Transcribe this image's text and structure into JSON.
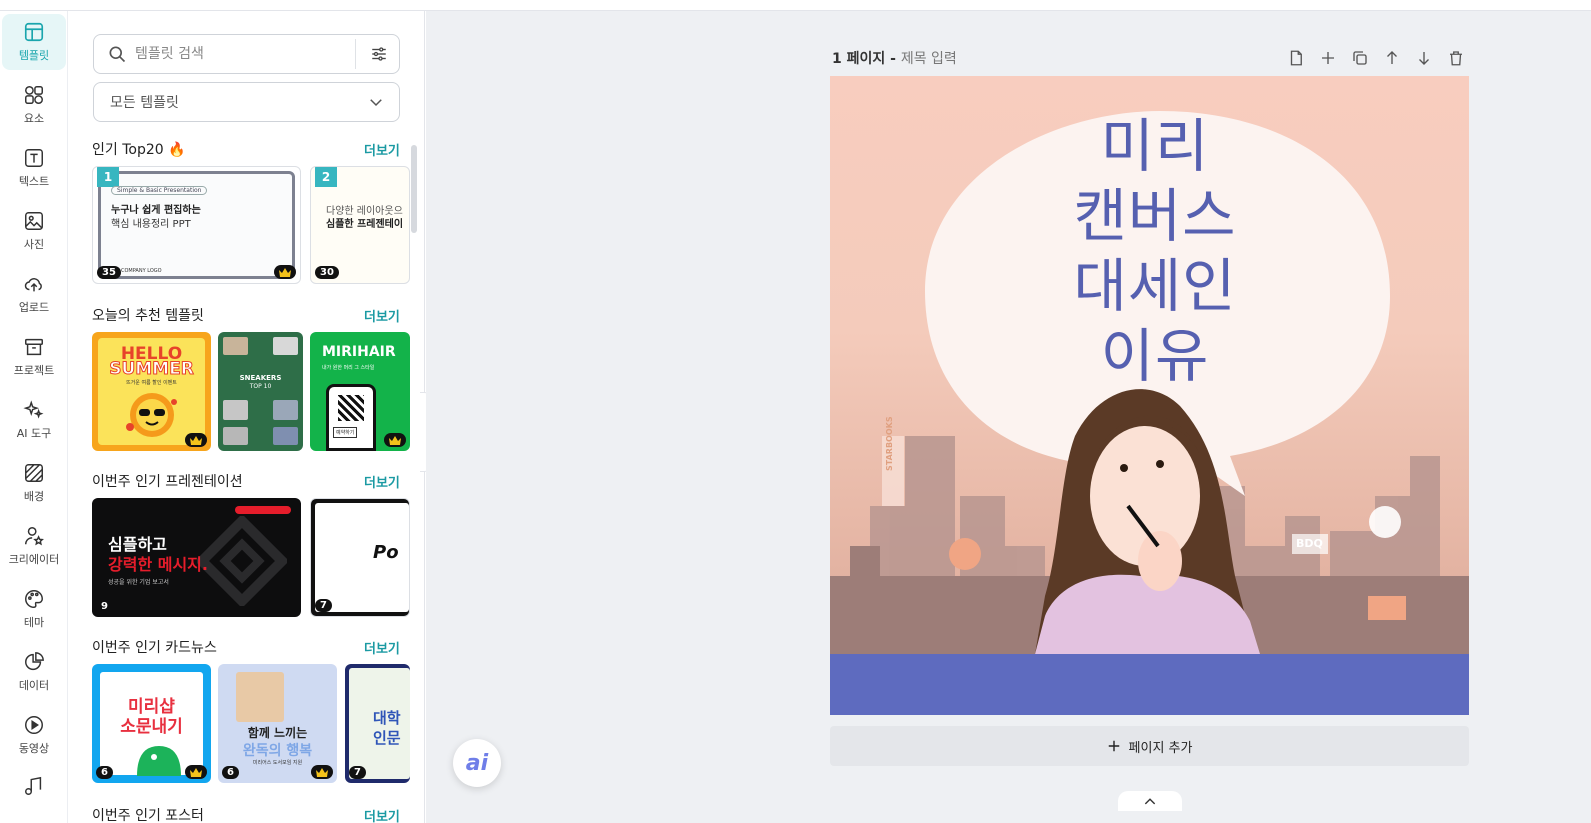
{
  "rail": {
    "items": [
      {
        "label": "템플릿"
      },
      {
        "label": "요소"
      },
      {
        "label": "텍스트"
      },
      {
        "label": "사진"
      },
      {
        "label": "업로드"
      },
      {
        "label": "프로젝트"
      },
      {
        "label": "AI 도구"
      },
      {
        "label": "배경"
      },
      {
        "label": "크리에이터"
      },
      {
        "label": "테마"
      },
      {
        "label": "데이터"
      },
      {
        "label": "동영상"
      }
    ]
  },
  "panel": {
    "search_placeholder": "템플릿 검색",
    "dropdown_value": "모든 템플릿",
    "sections": [
      {
        "title": "인기 Top20 🔥",
        "more": "더보기"
      },
      {
        "title": "오늘의 추천 템플릿",
        "more": "더보기"
      },
      {
        "title": "이번주 인기 프레젠테이션",
        "more": "더보기"
      },
      {
        "title": "이번주 인기 카드뉴스",
        "more": "더보기"
      },
      {
        "title": "이번주 인기 포스터",
        "more": "더보기"
      }
    ],
    "top20": [
      {
        "rank": "1",
        "count": "35",
        "tag": "Simple & Basic Presentation",
        "line1": "누구나 쉽게 편집하는",
        "line2": "핵심 내용정리 PPT",
        "footer": "COMPANY LOGO"
      },
      {
        "rank": "2",
        "count": "30",
        "line1": "다양한 레이아웃으",
        "line2": "심플한 프레젠테이"
      }
    ],
    "recommend": [
      {
        "line1": "HELLO",
        "line2": "SUMMER",
        "sub": "뜨거운 여름 할인 이벤트"
      },
      {
        "line1": "SNEAKERS",
        "line2": "TOP 10"
      },
      {
        "line1": "MIRIHAIR",
        "sub": "내가 원한 머리 그 스타일",
        "btn": "예약하기"
      }
    ],
    "presentations": [
      {
        "count": "9",
        "line1": "심플하고",
        "line2": "강력한 메시지.",
        "sub": "성공을 위한 기업 보고서"
      },
      {
        "count": "7",
        "line1": "Po"
      }
    ],
    "cardnews": [
      {
        "count": "6",
        "line1": "미리샵",
        "line2": "소문내기"
      },
      {
        "count": "6",
        "line1": "함께 느끼는",
        "line2": "완독의 행복",
        "sub": "미리어스 도서모임 지원"
      },
      {
        "count": "7",
        "line1": "대학",
        "line2": "인문"
      }
    ]
  },
  "page": {
    "label": "1 페이지 - ",
    "title_placeholder": "제목 입력",
    "headline": [
      "미리",
      "캔버스",
      "대세인",
      "이유"
    ],
    "signs": {
      "left": "STARBOOKS",
      "right": "BDQ"
    },
    "add_page": "페이지 추가",
    "ai_label": "ai"
  },
  "colors": {
    "accent": "#1b9aa3",
    "canvas_bottom": "#5e6bbf",
    "headline": "#5660b0"
  }
}
